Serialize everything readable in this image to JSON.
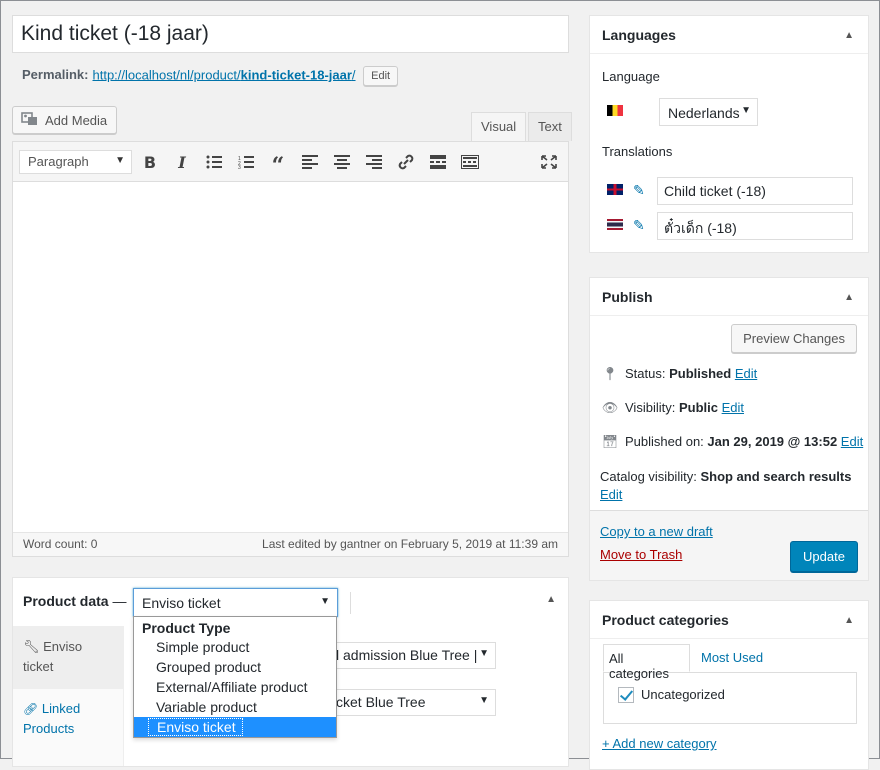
{
  "post": {
    "title": "Kind ticket (-18 jaar)",
    "permalink_label": "Permalink:",
    "permalink_url": "http://localhost/nl/product/kind-ticket-18-jaar/",
    "permalink_url_plain": "http://localhost/nl/product/",
    "permalink_slug": "kind-ticket-18-jaar",
    "permalink_edit": "Edit"
  },
  "editor": {
    "add_media": "Add Media",
    "tab_visual": "Visual",
    "tab_text": "Text",
    "format": "Paragraph",
    "toolbar_icons": [
      "bold-icon",
      "italic-icon",
      "bullet-list-icon",
      "numbered-list-icon",
      "blockquote-icon",
      "align-left-icon",
      "align-center-icon",
      "align-right-icon",
      "link-icon",
      "read-more-icon",
      "toolbar-toggle-icon",
      "fullscreen-icon"
    ],
    "word_count": "Word count: 0",
    "last_edited": "Last edited by gantner on February 5, 2019 at 11:39 am"
  },
  "product_data": {
    "label": "Product data",
    "dash": "—",
    "type_selected": "Enviso ticket",
    "tabs": [
      {
        "label": "Enviso ticket",
        "icon": "wrench-icon"
      },
      {
        "label": "Linked Products",
        "icon": "link-icon"
      }
    ],
    "field1": "l admission Blue Tree |",
    "field2": "cket Blue Tree",
    "dropdown": {
      "group": "Product Type",
      "options": [
        "Simple product",
        "Grouped product",
        "External/Affiliate product",
        "Variable product",
        "Enviso ticket"
      ],
      "selected": "Enviso ticket"
    }
  },
  "languages": {
    "title": "Languages",
    "language_label": "Language",
    "language_value": "Nederlands",
    "translations_label": "Translations",
    "translations": [
      {
        "flag": "en-flag",
        "value": "Child ticket (-18)"
      },
      {
        "flag": "th-flag",
        "value": "ตั๋วเด็ก (-18)"
      }
    ]
  },
  "publish": {
    "title": "Publish",
    "preview": "Preview Changes",
    "status_label": "Status:",
    "status_value": "Published",
    "visibility_label": "Visibility:",
    "visibility_value": "Public",
    "published_label": "Published on:",
    "published_value": "Jan 29, 2019 @ 13:52",
    "catalog_label": "Catalog visibility:",
    "catalog_value": "Shop and search results",
    "edit": "Edit",
    "copy_draft": "Copy to a new draft",
    "trash": "Move to Trash",
    "update": "Update"
  },
  "categories": {
    "title": "Product categories",
    "tab_all": "All categories",
    "tab_used": "Most Used",
    "items": [
      {
        "label": "Uncategorized",
        "checked": true
      }
    ],
    "add_new": "+ Add new category"
  }
}
